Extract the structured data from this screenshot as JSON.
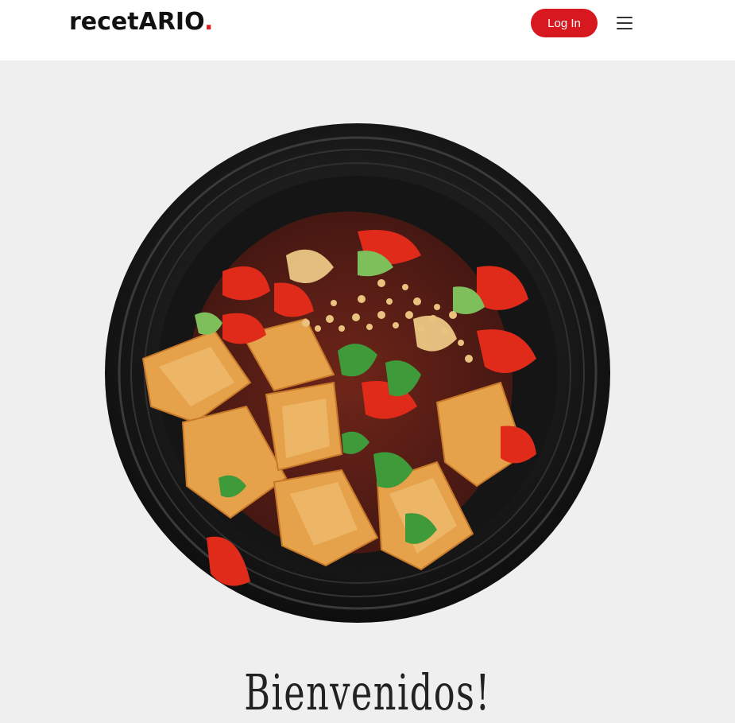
{
  "header": {
    "logo_text": "recetARIO",
    "logo_dot": ".",
    "login_label": "Log In",
    "menu_icon": "hamburger-menu-icon"
  },
  "hero": {
    "image_icon": "food-bowl-image",
    "welcome_title": "Bienvenidos!"
  },
  "colors": {
    "accent": "#d8181f",
    "background": "#efefef",
    "header_bg": "#ffffff"
  }
}
